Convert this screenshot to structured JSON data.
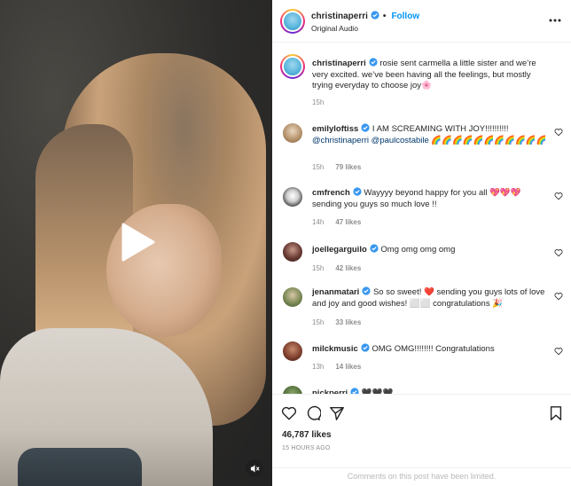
{
  "post": {
    "username": "christinaperri",
    "follow_label": "Follow",
    "audio_label": "Original Audio",
    "caption": {
      "username": "christinaperri",
      "text": "rosie sent carmella a little sister and we’re very excited. we’ve been having all the feelings, but mostly trying everyday to choose joy🌸",
      "time": "15h"
    },
    "like_count": "46,787 likes",
    "posted_time": "15 HOURS AGO",
    "comments_limited": "Comments on this post have been limited."
  },
  "comments": [
    {
      "username": "emilyloftiss",
      "text_prefix": "I AM SCREAMING WITH JOY!!!!!!!!!! ",
      "tag1": "@christinaperri",
      "tag2": "@paulcostabile",
      "text_suffix": " 🌈🌈🌈🌈🌈🌈🌈🌈🌈🌈🌈",
      "time": "15h",
      "likes": "79 likes"
    },
    {
      "username": "cmfrench",
      "text": "Wayyyy beyond happy for you all 💖💖💖 sending you guys so much love !!",
      "time": "14h",
      "likes": "47 likes"
    },
    {
      "username": "joellegarguilo",
      "text": "Omg omg omg omg",
      "time": "15h",
      "likes": "42 likes"
    },
    {
      "username": "jenanmatari",
      "text": "So so sweet! ❤️ sending you guys lots of love and joy and good wishes! ⬜⬜ congratulations 🎉",
      "time": "15h",
      "likes": "33 likes"
    },
    {
      "username": "milckmusic",
      "text": "OMG OMG!!!!!!!! Congratulations",
      "time": "13h",
      "likes": "14 likes"
    },
    {
      "username": "nickperri",
      "text": "🖤🖤🖤"
    }
  ],
  "icons": {
    "play": "play-icon",
    "mute": "speaker-muted-icon",
    "more": "more-horizontal-icon",
    "verified": "verified-badge-icon",
    "like": "heart-icon",
    "comment": "comment-icon",
    "share": "paper-plane-icon",
    "save": "bookmark-icon"
  },
  "colors": {
    "accent": "#0095f6",
    "verified": "#3897f0",
    "text": "#262626",
    "muted": "#8e8e8e"
  }
}
